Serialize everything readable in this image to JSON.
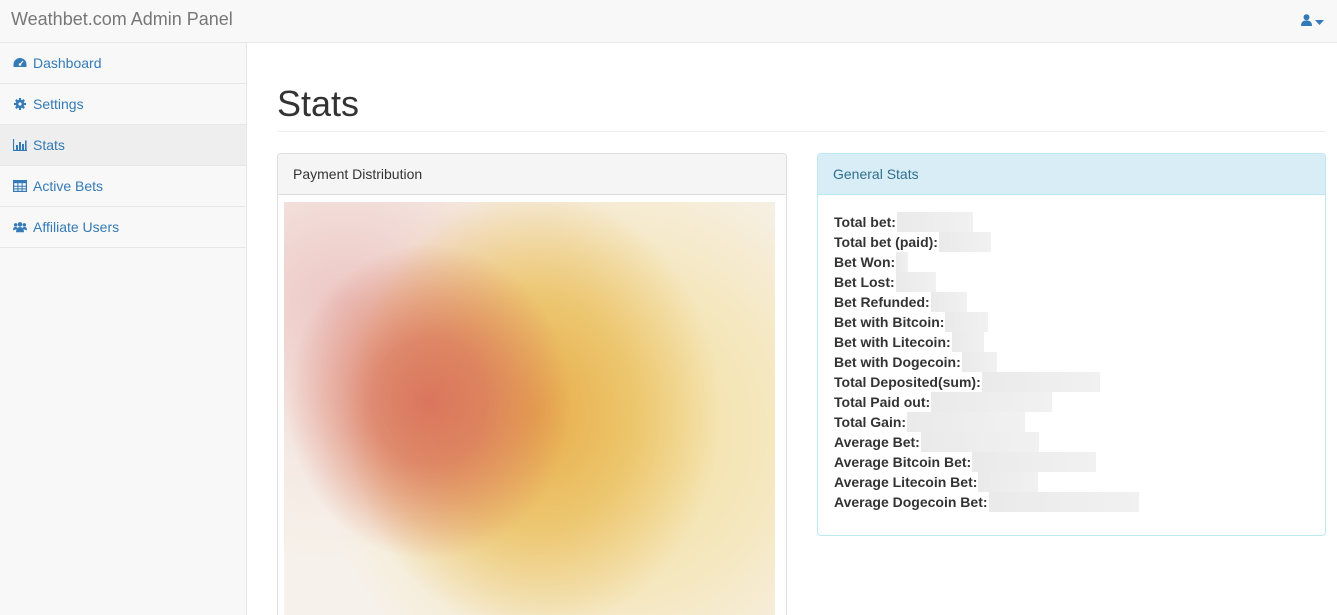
{
  "navbar": {
    "brand": "Weathbet.com Admin Panel",
    "user_icon": "user-icon",
    "caret_icon": "caret-down-icon",
    "colors": {
      "background": "#f8f8f8",
      "brand_text": "#777777",
      "link": "#337ab7"
    }
  },
  "sidebar": {
    "items": [
      {
        "label": "Dashboard",
        "icon": "dashboard-icon"
      },
      {
        "label": "Settings",
        "icon": "gear-icon"
      },
      {
        "label": "Stats",
        "icon": "bar-chart-icon",
        "active": true
      },
      {
        "label": "Active Bets",
        "icon": "table-icon"
      },
      {
        "label": "Affiliate Users",
        "icon": "users-icon"
      }
    ]
  },
  "main": {
    "title": "Stats",
    "payment_panel": {
      "heading": "Payment Distribution"
    },
    "stats_panel": {
      "heading": "General Stats",
      "rows": [
        {
          "label": "Total bet:"
        },
        {
          "label": "Total bet (paid):"
        },
        {
          "label": "Bet Won:"
        },
        {
          "label": "Bet Lost:"
        },
        {
          "label": "Bet Refunded:"
        },
        {
          "label": "Bet with Bitcoin:"
        },
        {
          "label": "Bet with Litecoin:"
        },
        {
          "label": "Bet with Dogecoin:"
        },
        {
          "label": "Total Deposited(sum):"
        },
        {
          "label": "Total Paid out:"
        },
        {
          "label": "Total Gain:"
        },
        {
          "label": "Average Bet:"
        },
        {
          "label": "Average Bitcoin Bet:"
        },
        {
          "label": "Average Litecoin Bet:"
        },
        {
          "label": "Average Dogecoin Bet:"
        }
      ]
    }
  }
}
